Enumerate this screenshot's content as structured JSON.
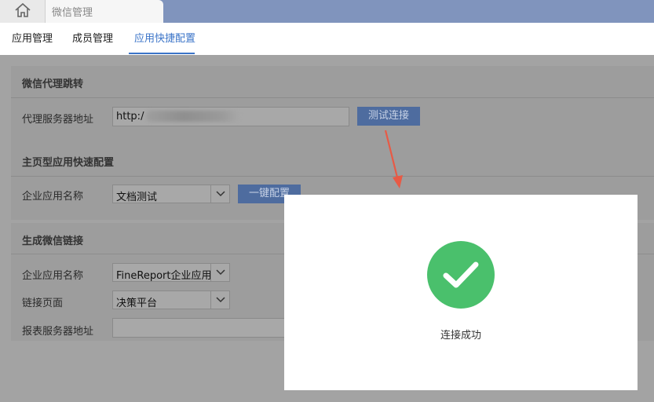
{
  "tabs": {
    "home_icon": "home-icon",
    "active_tab_label": "微信管理"
  },
  "subnav": {
    "items": [
      "应用管理",
      "成员管理",
      "应用快捷配置"
    ],
    "active_index": 2
  },
  "sections": {
    "proxy": {
      "title": "微信代理跳转",
      "label": "代理服务器地址",
      "value": "http:/",
      "button": "测试连接"
    },
    "homepage": {
      "title": "主页型应用快速配置",
      "label": "企业应用名称",
      "select_value": "文档测试",
      "button": "一键配置"
    },
    "link": {
      "title": "生成微信链接",
      "app_label": "企业应用名称",
      "app_value": "FineReport企业应用",
      "page_label": "链接页面",
      "page_value": "决策平台",
      "server_label": "报表服务器地址",
      "server_value": ""
    }
  },
  "modal": {
    "icon": "check-circle-icon",
    "message": "连接成功"
  },
  "colors": {
    "accent": "#3b74c8",
    "success": "#4ac06c",
    "annotation_arrow": "#e85a45"
  }
}
